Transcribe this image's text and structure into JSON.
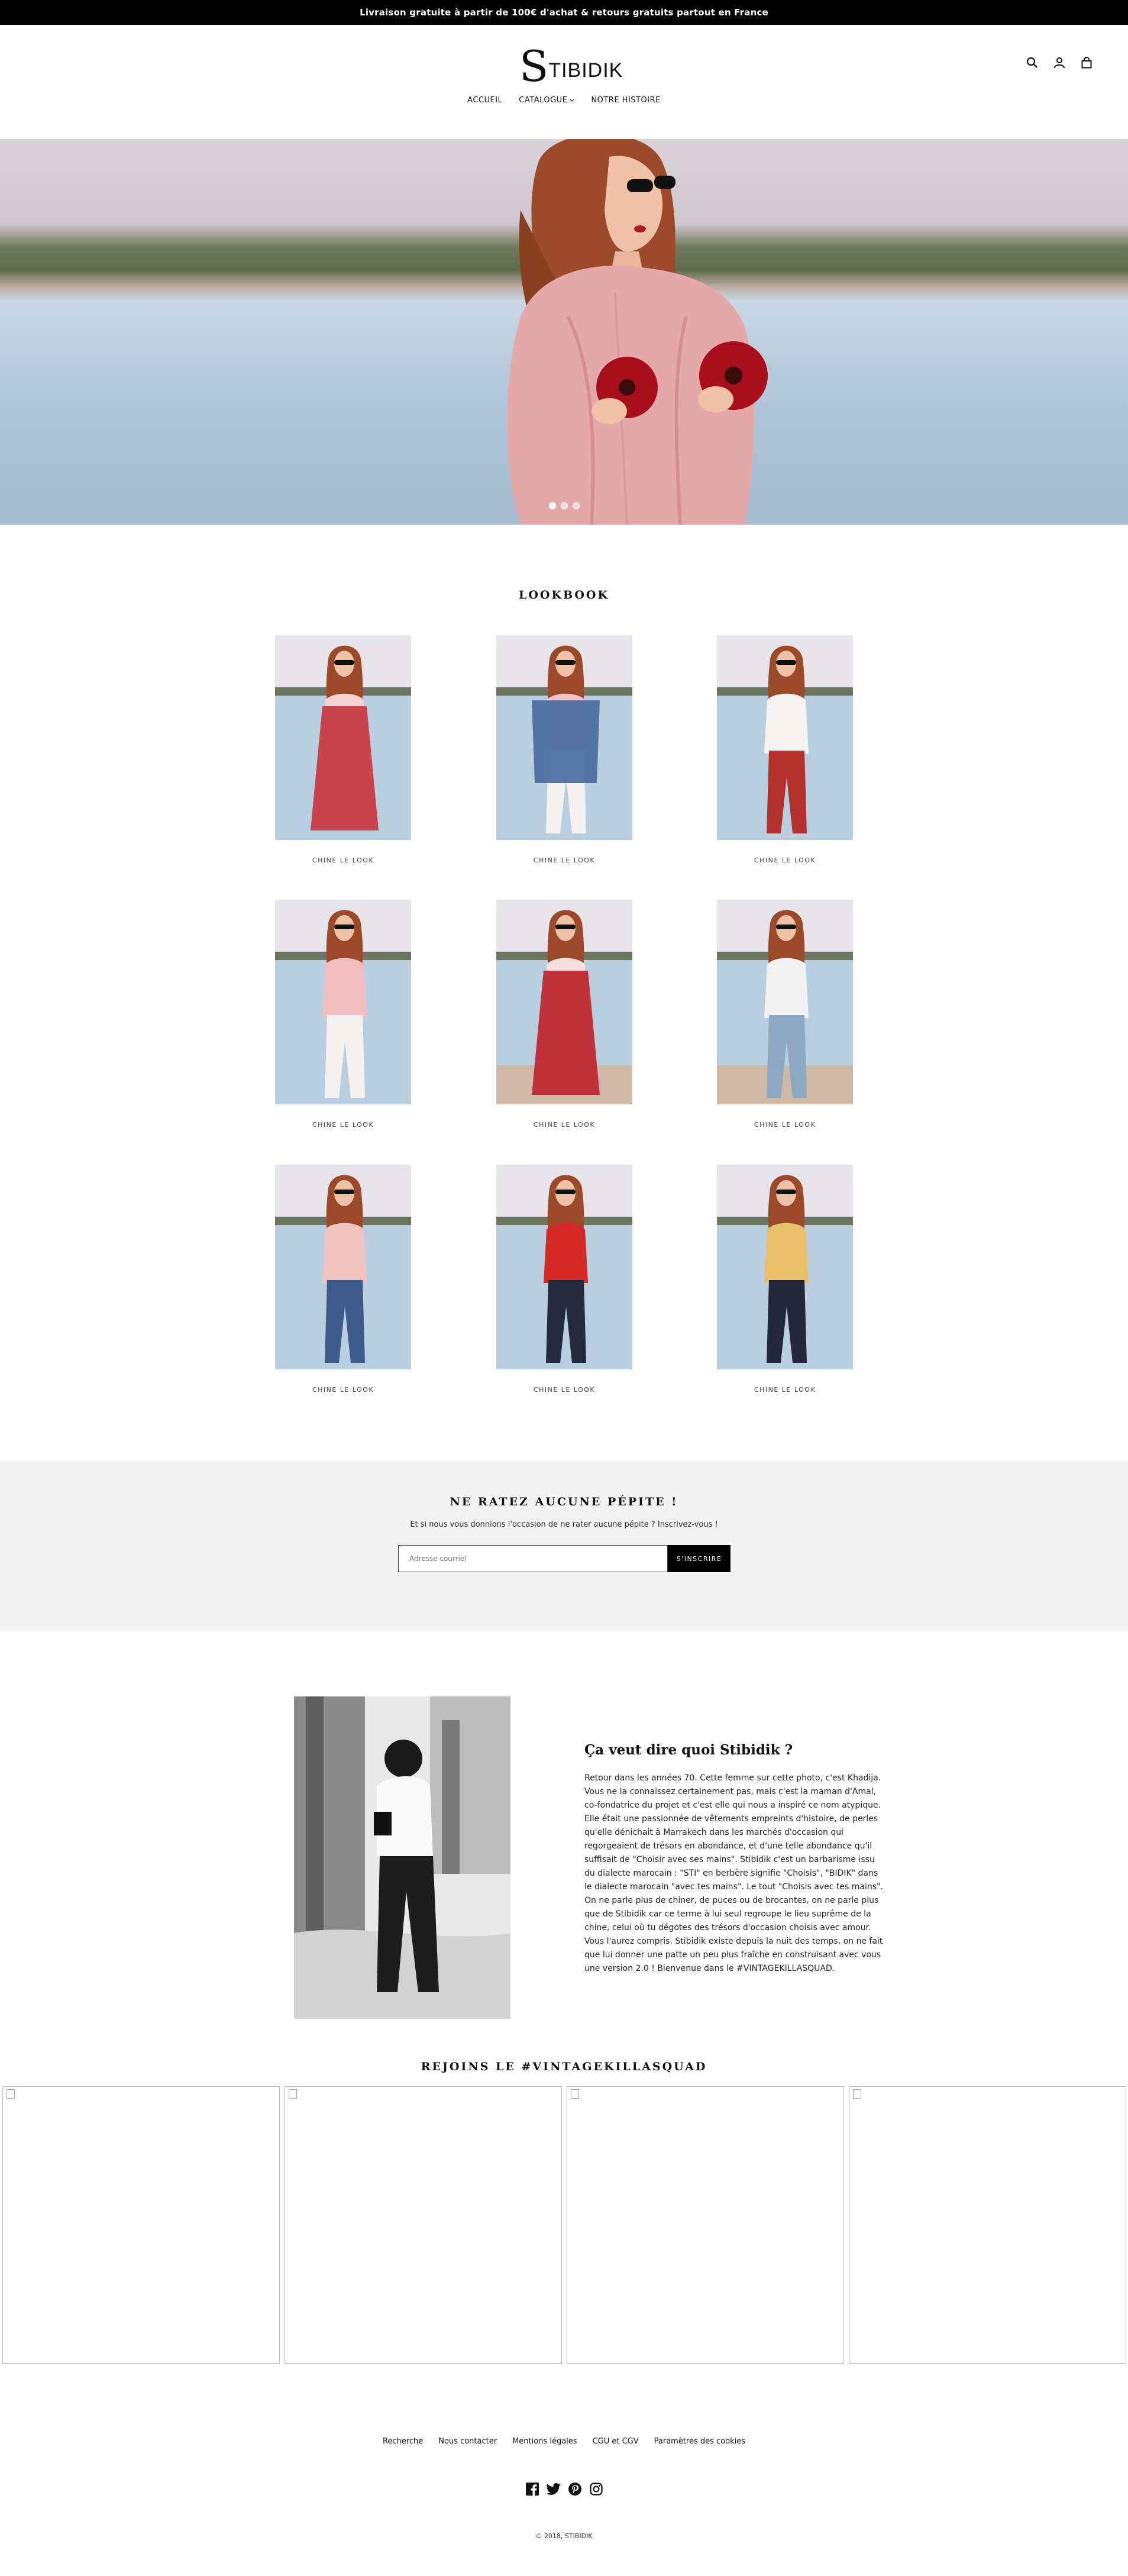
{
  "announcement": "Livraison gratuite à partir de 100€ d'achat & retours gratuits partout en France",
  "header": {
    "logo_initial": "S",
    "logo_rest": "TIBIDIK",
    "nav": [
      {
        "label": "ACCUEIL"
      },
      {
        "label": "CATALOGUE"
      },
      {
        "label": "NOTRE HISTOIRE"
      }
    ],
    "icons": [
      "search-icon",
      "account-icon",
      "cart-icon"
    ]
  },
  "hero": {
    "slides_total": 3,
    "active_slide": 1
  },
  "lookbook": {
    "title": "LOOKBOOK",
    "items": [
      {
        "caption": "CHINE LE LOOK"
      },
      {
        "caption": "CHINE LE LOOK"
      },
      {
        "caption": "CHINE LE LOOK"
      },
      {
        "caption": "CHINE LE LOOK"
      },
      {
        "caption": "CHINE LE LOOK"
      },
      {
        "caption": "CHINE LE LOOK"
      },
      {
        "caption": "CHINE LE LOOK"
      },
      {
        "caption": "CHINE LE LOOK"
      },
      {
        "caption": "CHINE LE LOOK"
      }
    ]
  },
  "newsletter": {
    "title": "NE RATEZ AUCUNE PÉPITE !",
    "subtitle": "Et si nous vous donnions l'occasion de ne rater aucune pépite ? Inscrivez-vous !",
    "placeholder": "Adresse courriel",
    "button": "S'INSCRIRE"
  },
  "about": {
    "title": "Ça veut dire quoi Stibidik ?",
    "text": "Retour dans les années 70. Cette femme sur cette photo, c'est Khadija. Vous ne la connaissez certainement pas, mais c'est la maman d'Amal, co-fondatrice du projet et c'est elle qui nous a inspiré ce nom atypique. Elle était une passionnée de vêtements empreints d'histoire, de perles qu'elle dénichait à Marrakech dans les marchés d'occasion qui regorgeaient de trésors en abondance, et d'une telle abondance qu'il suffisait de \"Choisir avec ses mains\". Stibidik c'est un barbarisme issu du dialecte marocain : \"STI\" en berbère signifie \"Choisis\", \"BIDIK\" dans le dialecte marocain \"avec tes mains\". Le tout \"Choisis avec tes mains\". On ne parle plus de chiner, de puces ou de brocantes, on ne parle plus que de Stibidik car ce terme à lui seul regroupe le lieu suprême de la chine, celui où tu dégotes des trésors d'occasion choisis avec amour. Vous l'aurez compris, Stibidik existe depuis la nuit des temps, on ne fait que lui donner une patte un peu plus fraîche en construisant avec vous une version 2.0 ! Bienvenue dans le #VINTAGEKILLASQUAD."
  },
  "instagram": {
    "title": "REJOINS LE #VINTAGEKILLASQUAD",
    "tiles": 4
  },
  "footer": {
    "links": [
      "Recherche",
      "Nous contacter",
      "Mentions légales",
      "CGU et CGV",
      "Paramètres des cookies"
    ],
    "socials": [
      "facebook-icon",
      "twitter-icon",
      "pinterest-icon",
      "instagram-icon"
    ],
    "copyright": "© 2018, STIBIDIK"
  },
  "colors": {
    "announcement_bg": "#000000",
    "newsletter_bg": "#f3f3f3",
    "button_bg": "#000000"
  }
}
